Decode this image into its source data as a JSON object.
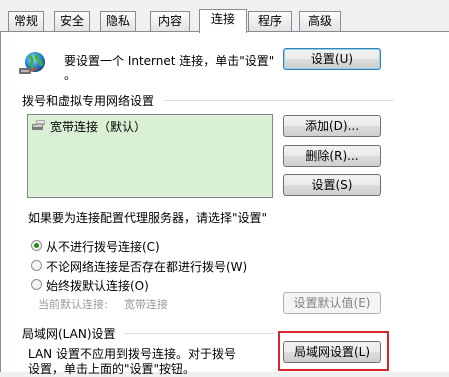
{
  "tabs": [
    {
      "label": "常规",
      "active": false
    },
    {
      "label": "安全",
      "active": false
    },
    {
      "label": "隐私",
      "active": false
    },
    {
      "label": "内容",
      "active": false
    },
    {
      "label": "连接",
      "active": true
    },
    {
      "label": "程序",
      "active": false
    },
    {
      "label": "高级",
      "active": false
    }
  ],
  "setup": {
    "text": "要设置一个 Internet 连接，单击\"设置\"",
    "bullet": "。",
    "button": "设置(U)"
  },
  "dialup": {
    "group_label": "拨号和虚拟专用网络设置",
    "connection_label": "宽带连接（默认）",
    "add_button": "添加(D)...",
    "delete_button": "删除(R)...",
    "settings_button": "设置(S)"
  },
  "proxy_hint": "如果要为连接配置代理服务器，请选择\"设置\"",
  "dial_options": [
    {
      "label": "从不进行拨号连接(C)",
      "checked": true
    },
    {
      "label": "不论网络连接是否存在都进行拨号(W)",
      "checked": false
    },
    {
      "label": "始终拨默认连接(O)",
      "checked": false
    }
  ],
  "default_conn": {
    "label": "当前默认连接:",
    "value": "宽带连接",
    "button": "设置默认值(E)"
  },
  "lan": {
    "group_label": "局域网(LAN)设置",
    "desc_line1": "LAN 设置不应用到拨号连接。对于拨号",
    "desc_line2": "设置，单击上面的\"设置\"按钮。",
    "button": "局域网设置(L)"
  },
  "colors": {
    "highlight": "#d8262d",
    "list_bg": "#d9f0d5"
  }
}
